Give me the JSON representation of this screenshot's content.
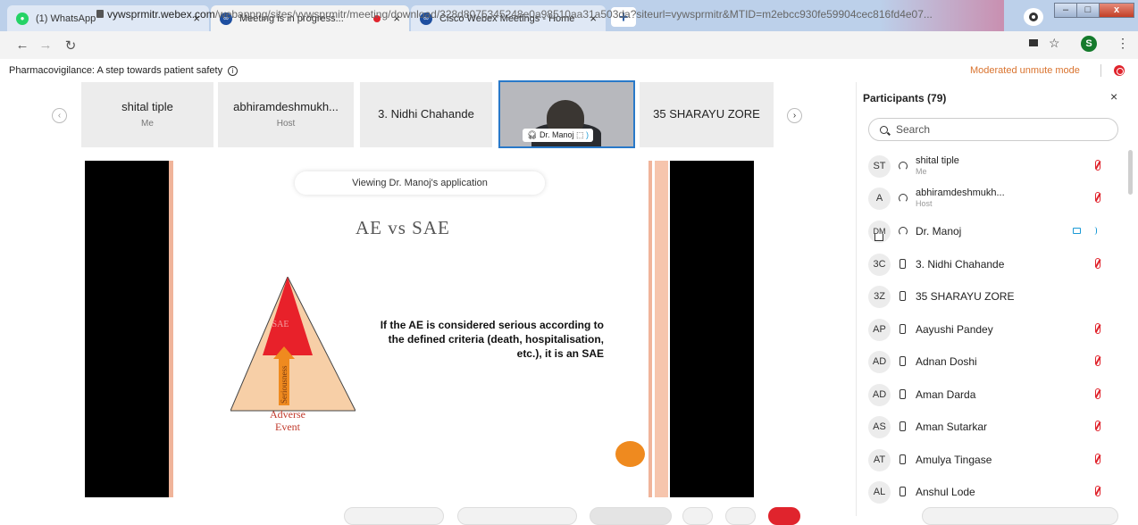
{
  "browser": {
    "tabs": [
      {
        "title": "(1) WhatsApp",
        "close": "×"
      },
      {
        "title": "Meeting is in progress...",
        "close": "×"
      },
      {
        "title": "Cisco Webex Meetings - Home",
        "close": "×"
      }
    ],
    "new_tab": "+",
    "url_host": "vywsprmitr.webex.com",
    "url_path": "/webappng/sites/vywsprmitr/meeting/download/328d8075345248e0a98510aa31a503da?siteurl=vywsprmitr&MTID=m2ebcc930fe59904cec816fd4e07...",
    "profile_initial": "S",
    "window_controls": {
      "minimize": "–",
      "maximize": "□",
      "close": "x"
    }
  },
  "meeting": {
    "title": "Pharmacovigilance: A step towards patient safety",
    "mode": "Moderated unmute mode",
    "thumbnails": [
      {
        "name": "shital tiple",
        "role": "Me"
      },
      {
        "name": "abhiramdeshmukh...",
        "role": "Host"
      },
      {
        "name": "3. Nidhi Chahande"
      },
      {
        "video_label": "Dr. Manoj"
      },
      {
        "name": "35 SHARAYU ZORE"
      }
    ]
  },
  "slide": {
    "viewing": "Viewing Dr. Manoj's application",
    "title": "AE vs SAE",
    "body": "If the AE is considered serious according to the defined criteria (death, hospitalisation, etc.), it is an SAE",
    "pyramid_top": "SAE",
    "pyramid_arrow": "Seriousness",
    "pyramid_bottom_1": "Adverse",
    "pyramid_bottom_2": "Event"
  },
  "participants": {
    "title": "Participants (79)",
    "close": "×",
    "search_placeholder": "Search",
    "list": [
      {
        "initials": "ST",
        "name": "shital tiple",
        "sub": "Me",
        "device": "headset",
        "muted": true
      },
      {
        "initials": "A",
        "name": "abhiramdeshmukh...",
        "sub": "Host",
        "device": "headset",
        "muted": true
      },
      {
        "initials": "DM",
        "name": "Dr. Manoj",
        "device": "headset",
        "muted": false,
        "presenting": true
      },
      {
        "initials": "3C",
        "name": "3. Nidhi Chahande",
        "device": "phone",
        "muted": true
      },
      {
        "initials": "3Z",
        "name": "35 SHARAYU ZORE",
        "device": "phone",
        "muted": false
      },
      {
        "initials": "AP",
        "name": "Aayushi Pandey",
        "device": "phone",
        "muted": true
      },
      {
        "initials": "AD",
        "name": "Adnan Doshi",
        "device": "phone",
        "muted": true
      },
      {
        "initials": "AD",
        "name": "Aman Darda",
        "device": "phone",
        "muted": true
      },
      {
        "initials": "AS",
        "name": "Aman Sutarkar",
        "device": "phone",
        "muted": true
      },
      {
        "initials": "AT",
        "name": "Amulya Tingase",
        "device": "phone",
        "muted": true
      },
      {
        "initials": "AL",
        "name": "Anshul Lode",
        "device": "phone",
        "muted": true
      }
    ]
  },
  "colors": {
    "accent_blue": "#2979c9",
    "mute_red": "#e0242d",
    "moderated_orange": "#d9732e",
    "pyramid_red": "#e8212a",
    "pyramid_peach": "#f7cfa7",
    "arrow_orange": "#ef8a1f"
  }
}
